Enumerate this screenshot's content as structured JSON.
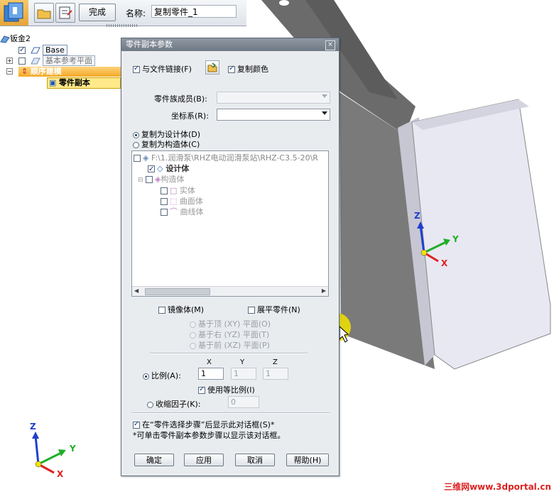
{
  "toolbar": {
    "finish_label": "完成",
    "name_label": "名称:",
    "name_value": "复制零件_1"
  },
  "pathfinder": {
    "items": [
      {
        "label": "钣金2"
      },
      {
        "label": "Base"
      },
      {
        "label": "基本参考平面"
      },
      {
        "label": "顺序建模"
      },
      {
        "label": "零件副本"
      }
    ]
  },
  "dialog": {
    "title": "零件副本参数",
    "close_glyph": "×",
    "link_to_file": "与文件链接(F)",
    "copy_color": "复制颜色",
    "family_member_label": "零件族成员(B):",
    "coord_label": "坐标系(R):",
    "copy_as_design": "复制为设计体(D)",
    "copy_as_construction": "复制为构造体(C)",
    "tree": {
      "root": "F:\\1.润滑泵\\RHZ电动润滑泵站\\RHZ-C3.5-20\\R",
      "design_body": "设计体",
      "construction": "构造体",
      "solid": "实体",
      "surface": "曲面体",
      "curve": "曲线体"
    },
    "mirror": "镜像体(M)",
    "flatten": "展平零件(N)",
    "plane_top": "基于顶 (XY) 平面(O)",
    "plane_right": "基于右 (YZ) 平面(T)",
    "plane_front": "基于前 (XZ) 平面(P)",
    "axis_x": "X",
    "axis_y": "Y",
    "axis_z": "Z",
    "scale_label": "比例(A):",
    "scale_x": "1",
    "scale_y": "1",
    "scale_z": "1",
    "uniform_scale": "使用等比例(I)",
    "shrink_label": "收缩因子(K):",
    "shrink_value": "0",
    "show_dialog": "在“零件选择步骤”后显示此对话框(S)*",
    "note": "*可单击零件副本参数步骤以显示该对话框。",
    "ok": "确定",
    "apply": "应用",
    "cancel": "取消",
    "help": "帮助(H)"
  },
  "triad_main": {
    "x": "X",
    "y": "Y",
    "z": "Z"
  },
  "triad_corner": {
    "x": "X",
    "y": "Y",
    "z": "Z"
  },
  "watermark": "三维网www.3dportal.cn",
  "colors": {
    "accent_orange": "#f3a826",
    "axis_x": "#e02020",
    "axis_y": "#1fae2a",
    "axis_z": "#1f3fcf",
    "cursor_highlight": "#f2e300"
  }
}
